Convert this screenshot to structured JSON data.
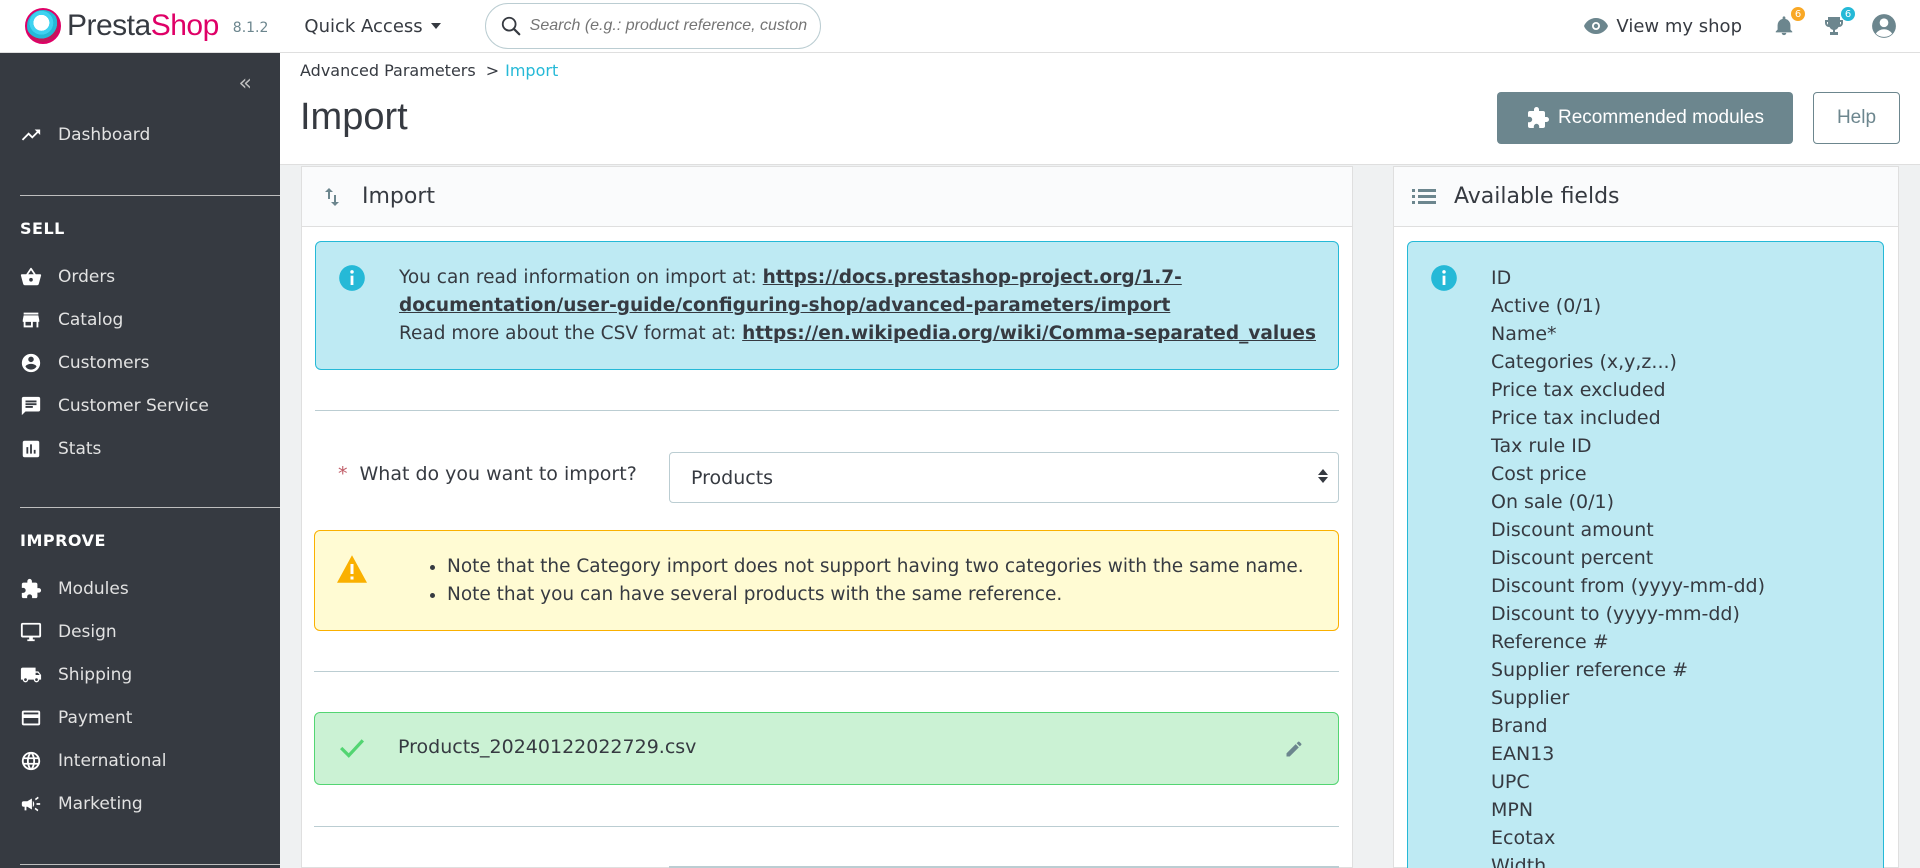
{
  "header": {
    "logo_text_presta": "Presta",
    "logo_text_shop": "Shop",
    "version": "8.1.2",
    "quick_access": "Quick Access",
    "search_placeholder": "Search (e.g.: product reference, custon",
    "view_shop": "View my shop",
    "notifications_count": "6",
    "trophy_count": "6"
  },
  "sidebar": {
    "dashboard": "Dashboard",
    "sell_title": "SELL",
    "sell_items": [
      "Orders",
      "Catalog",
      "Customers",
      "Customer Service",
      "Stats"
    ],
    "improve_title": "IMPROVE",
    "improve_items": [
      "Modules",
      "Design",
      "Shipping",
      "Payment",
      "International",
      "Marketing"
    ]
  },
  "breadcrumb": {
    "parent": "Advanced Parameters",
    "separator": ">",
    "current": "Import"
  },
  "page": {
    "title": "Import",
    "recommended_modules": "Recommended modules",
    "help": "Help"
  },
  "import_panel": {
    "title": "Import",
    "info_prefix_1": "You can read information on import at: ",
    "info_link_1": "https://docs.prestashop-project.org/1.7-documentation/user-guide/configuring-shop/advanced-parameters/import",
    "info_prefix_2": "Read more about the CSV format at: ",
    "info_link_2": "https://en.wikipedia.org/wiki/Comma-separated_values",
    "question_label": "What do you want to import?",
    "required_mark": "*",
    "selected_entity": "Products",
    "warnings": [
      "Note that the Category import does not support having two categories with the same name.",
      "Note that you can have several products with the same reference."
    ],
    "file_name": "Products_20240122022729.csv"
  },
  "fields_panel": {
    "title": "Available fields",
    "fields": [
      "ID",
      "Active (0/1)",
      "Name*",
      "Categories (x,y,z...)",
      "Price tax excluded",
      "Price tax included",
      "Tax rule ID",
      "Cost price",
      "On sale (0/1)",
      "Discount amount",
      "Discount percent",
      "Discount from (yyyy-mm-dd)",
      "Discount to (yyyy-mm-dd)",
      "Reference #",
      "Supplier reference #",
      "Supplier",
      "Brand",
      "EAN13",
      "UPC",
      "MPN",
      "Ecotax",
      "Width"
    ]
  },
  "colors": {
    "brand_pink": "#df0067",
    "accent_blue": "#25b9d7",
    "sidebar_bg": "#363a41",
    "info_bg": "#beeaf3",
    "warn_bg": "#fffbd3",
    "success_bg": "#cbf2d4"
  }
}
